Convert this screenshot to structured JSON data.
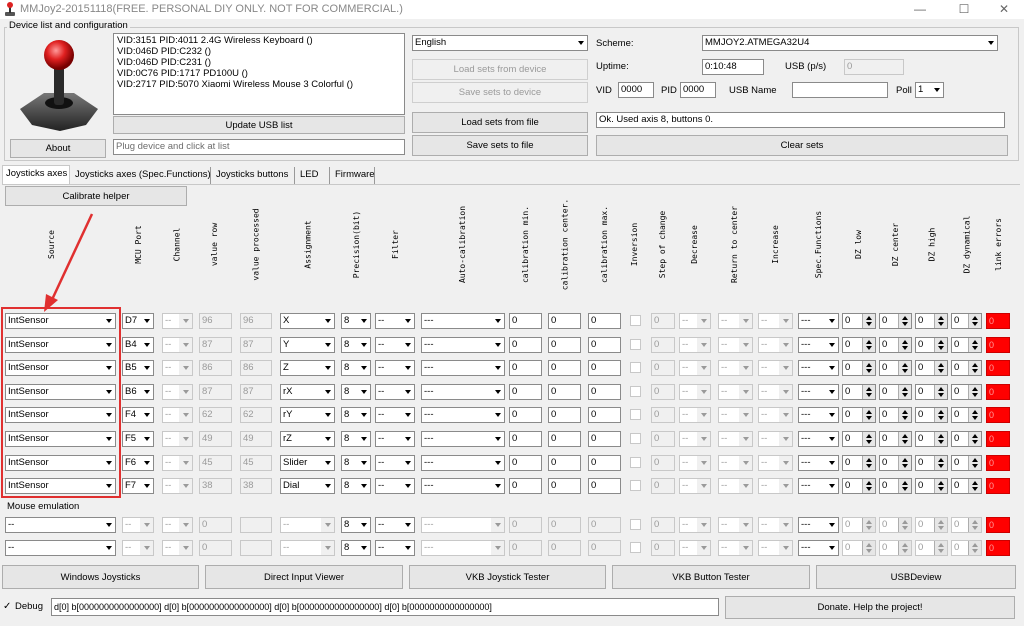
{
  "window": {
    "title": "MMJoy2-20151118(FREE. PERSONAL DIY ONLY. NOT FOR COMMERCIAL.)",
    "minimize": "—",
    "maximize": "☐",
    "close": "✕"
  },
  "device_group": {
    "label": "Device list and configuration",
    "devices": [
      "VID:3151 PID:4011 2.4G Wireless Keyboard ()",
      "VID:046D PID:C232  ()",
      "VID:046D PID:C231  ()",
      "VID:0C76 PID:1717 PD100U ()",
      "VID:2717 PID:5070 Xiaomi Wireless Mouse 3 Colorful ()"
    ],
    "about_button": "About",
    "update_usb_button": "Update USB list",
    "status_placeholder": "Plug device and click at list",
    "language": "English",
    "load_from_device": "Load sets from device",
    "save_to_device": "Save sets to device",
    "load_from_file": "Load sets from file",
    "save_to_file": "Save sets to file",
    "scheme_label": "Scheme:",
    "scheme_value": "MMJOY2.ATMEGA32U4",
    "uptime_label": "Uptime:",
    "uptime_value": "0:10:48",
    "usb_label": "USB (p/s)",
    "usb_value": "0",
    "vid_label": "VID",
    "vid_value": "0000",
    "pid_label": "PID",
    "pid_value": "0000",
    "usbname_label": "USB Name",
    "usbname_value": "",
    "poll_label": "Poll",
    "poll_value": "1",
    "status_message": "Ok. Used axis  8, buttons 0.",
    "clear_sets_button": "Clear sets"
  },
  "tabs": [
    "Joysticks axes",
    "Joysticks axes (Spec.Functions)",
    "Joysticks buttons",
    "LED",
    "Firmware"
  ],
  "axes": {
    "calibrate_button": "Calibrate helper",
    "headers": [
      "Source",
      "MCU Port",
      "Channel",
      "value row",
      "value processed",
      "Assignment",
      "Precision(bit)",
      "Filter",
      "Auto-calibration",
      "calibration min.",
      "calibration center.",
      "calibration max.",
      "Inversion",
      "Step of change",
      "Decrease",
      "Return to center",
      "Increase",
      "Spec.Functions",
      "DZ low",
      "DZ center",
      "DZ high",
      "DZ dynamical",
      "link errors"
    ],
    "rows": [
      {
        "source": "IntSensor",
        "port": "D7",
        "channel": "--",
        "raw": "96",
        "processed": "96",
        "assign": "X",
        "precision": "8",
        "filter": "--",
        "autocal": "---",
        "cal_min": "0",
        "cal_center": "0",
        "cal_max": "0",
        "step": "0",
        "decrease": "--",
        "ret": "--",
        "increase": "--",
        "spec": "---",
        "dz_low": "0",
        "dz_center": "0",
        "dz_high": "0",
        "dz_dyn": "0",
        "err": "0"
      },
      {
        "source": "IntSensor",
        "port": "B4",
        "channel": "--",
        "raw": "87",
        "processed": "87",
        "assign": "Y",
        "precision": "8",
        "filter": "--",
        "autocal": "---",
        "cal_min": "0",
        "cal_center": "0",
        "cal_max": "0",
        "step": "0",
        "decrease": "--",
        "ret": "--",
        "increase": "--",
        "spec": "---",
        "dz_low": "0",
        "dz_center": "0",
        "dz_high": "0",
        "dz_dyn": "0",
        "err": "0"
      },
      {
        "source": "IntSensor",
        "port": "B5",
        "channel": "--",
        "raw": "86",
        "processed": "86",
        "assign": "Z",
        "precision": "8",
        "filter": "--",
        "autocal": "---",
        "cal_min": "0",
        "cal_center": "0",
        "cal_max": "0",
        "step": "0",
        "decrease": "--",
        "ret": "--",
        "increase": "--",
        "spec": "---",
        "dz_low": "0",
        "dz_center": "0",
        "dz_high": "0",
        "dz_dyn": "0",
        "err": "0"
      },
      {
        "source": "IntSensor",
        "port": "B6",
        "channel": "--",
        "raw": "87",
        "processed": "87",
        "assign": "rX",
        "precision": "8",
        "filter": "--",
        "autocal": "---",
        "cal_min": "0",
        "cal_center": "0",
        "cal_max": "0",
        "step": "0",
        "decrease": "--",
        "ret": "--",
        "increase": "--",
        "spec": "---",
        "dz_low": "0",
        "dz_center": "0",
        "dz_high": "0",
        "dz_dyn": "0",
        "err": "0"
      },
      {
        "source": "IntSensor",
        "port": "F4",
        "channel": "--",
        "raw": "62",
        "processed": "62",
        "assign": "rY",
        "precision": "8",
        "filter": "--",
        "autocal": "---",
        "cal_min": "0",
        "cal_center": "0",
        "cal_max": "0",
        "step": "0",
        "decrease": "--",
        "ret": "--",
        "increase": "--",
        "spec": "---",
        "dz_low": "0",
        "dz_center": "0",
        "dz_high": "0",
        "dz_dyn": "0",
        "err": "0"
      },
      {
        "source": "IntSensor",
        "port": "F5",
        "channel": "--",
        "raw": "49",
        "processed": "49",
        "assign": "rZ",
        "precision": "8",
        "filter": "--",
        "autocal": "---",
        "cal_min": "0",
        "cal_center": "0",
        "cal_max": "0",
        "step": "0",
        "decrease": "--",
        "ret": "--",
        "increase": "--",
        "spec": "---",
        "dz_low": "0",
        "dz_center": "0",
        "dz_high": "0",
        "dz_dyn": "0",
        "err": "0"
      },
      {
        "source": "IntSensor",
        "port": "F6",
        "channel": "--",
        "raw": "45",
        "processed": "45",
        "assign": "Slider",
        "precision": "8",
        "filter": "--",
        "autocal": "---",
        "cal_min": "0",
        "cal_center": "0",
        "cal_max": "0",
        "step": "0",
        "decrease": "--",
        "ret": "--",
        "increase": "--",
        "spec": "---",
        "dz_low": "0",
        "dz_center": "0",
        "dz_high": "0",
        "dz_dyn": "0",
        "err": "0"
      },
      {
        "source": "IntSensor",
        "port": "F7",
        "channel": "--",
        "raw": "38",
        "processed": "38",
        "assign": "Dial",
        "precision": "8",
        "filter": "--",
        "autocal": "---",
        "cal_min": "0",
        "cal_center": "0",
        "cal_max": "0",
        "step": "0",
        "decrease": "--",
        "ret": "--",
        "increase": "--",
        "spec": "---",
        "dz_low": "0",
        "dz_center": "0",
        "dz_high": "0",
        "dz_dyn": "0",
        "err": "0"
      }
    ],
    "mouse_label": "Mouse emulation",
    "mouse_rows": [
      {
        "source": "--",
        "port": "--",
        "channel": "--",
        "raw": "0",
        "processed": "",
        "assign": "--",
        "precision": "8",
        "filter": "--",
        "autocal": "---",
        "cal_min": "0",
        "cal_center": "0",
        "cal_max": "0",
        "step": "0",
        "decrease": "--",
        "ret": "--",
        "increase": "--",
        "spec": "---",
        "dz_low": "0",
        "dz_center": "0",
        "dz_high": "0",
        "dz_dyn": "0",
        "err": "0"
      },
      {
        "source": "--",
        "port": "--",
        "channel": "--",
        "raw": "0",
        "processed": "",
        "assign": "--",
        "precision": "8",
        "filter": "--",
        "autocal": "---",
        "cal_min": "0",
        "cal_center": "0",
        "cal_max": "0",
        "step": "0",
        "decrease": "--",
        "ret": "--",
        "increase": "--",
        "spec": "---",
        "dz_low": "0",
        "dz_center": "0",
        "dz_high": "0",
        "dz_dyn": "0",
        "err": "0"
      }
    ]
  },
  "bottom": {
    "buttons": [
      "Windows Joysticks",
      "Direct Input Viewer",
      "VKB Joystick Tester",
      "VKB Button Tester",
      "USBDeview"
    ],
    "debug_label": "Debug",
    "debug_value": "d[0] b[0000000000000000]   d[0] b[0000000000000000]   d[0] b[0000000000000000]   d[0] b[0000000000000000]",
    "donate_button": "Donate. Help the project!"
  },
  "colors": {
    "error_red": "#ff0000",
    "highlight_red": "#e03030",
    "window_bg": "#f0f0f0"
  }
}
